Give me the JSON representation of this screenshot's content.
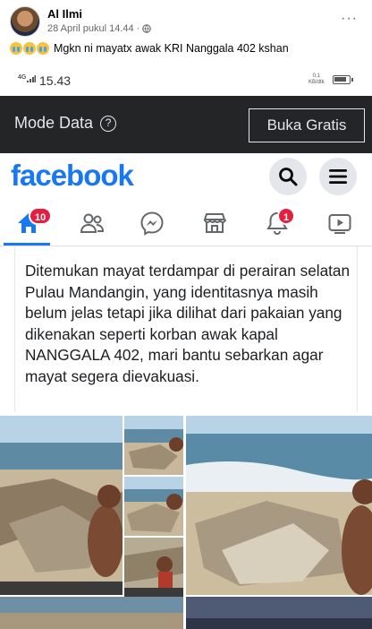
{
  "post": {
    "author": "Al Ilmi",
    "timestamp": "28 April pukul 14.44",
    "separator": "·",
    "more_label": "···",
    "caption": "Mgkn ni mayatx awak KRI Nanggala 402 kshan"
  },
  "status_bar": {
    "network": "4G",
    "time": "15.43",
    "speed_value": "0,1",
    "speed_unit": "KB/dtk",
    "battery_level": 0.85
  },
  "mode_bar": {
    "title": "Mode Data",
    "help_icon": "?",
    "button_label": "Buka Gratis"
  },
  "facebook": {
    "logo": "facebook",
    "search_icon": "search-icon",
    "menu_icon": "menu-icon",
    "nav": [
      {
        "name": "home",
        "icon": "home-icon",
        "badge": "10",
        "active": true
      },
      {
        "name": "friends",
        "icon": "friends-icon",
        "badge": ""
      },
      {
        "name": "messenger",
        "icon": "messenger-icon",
        "badge": ""
      },
      {
        "name": "marketplace",
        "icon": "marketplace-icon",
        "badge": ""
      },
      {
        "name": "notifications",
        "icon": "bell-icon",
        "badge": "1"
      },
      {
        "name": "watch",
        "icon": "watch-icon",
        "badge": ""
      }
    ],
    "post_text": "Ditemukan mayat terdampar di perairan selatan Pulau Mandangin, yang identitasnya masih belum jelas tetapi jika dilihat dari pakaian yang dikenakan seperti korban awak kapal NANGGALA 402, mari bantu sebarkan agar mayat segera dievakuasi."
  },
  "colors": {
    "facebook_blue": "#1877f2",
    "mode_bar_bg": "#242526",
    "badge_red": "#e41e3f"
  }
}
